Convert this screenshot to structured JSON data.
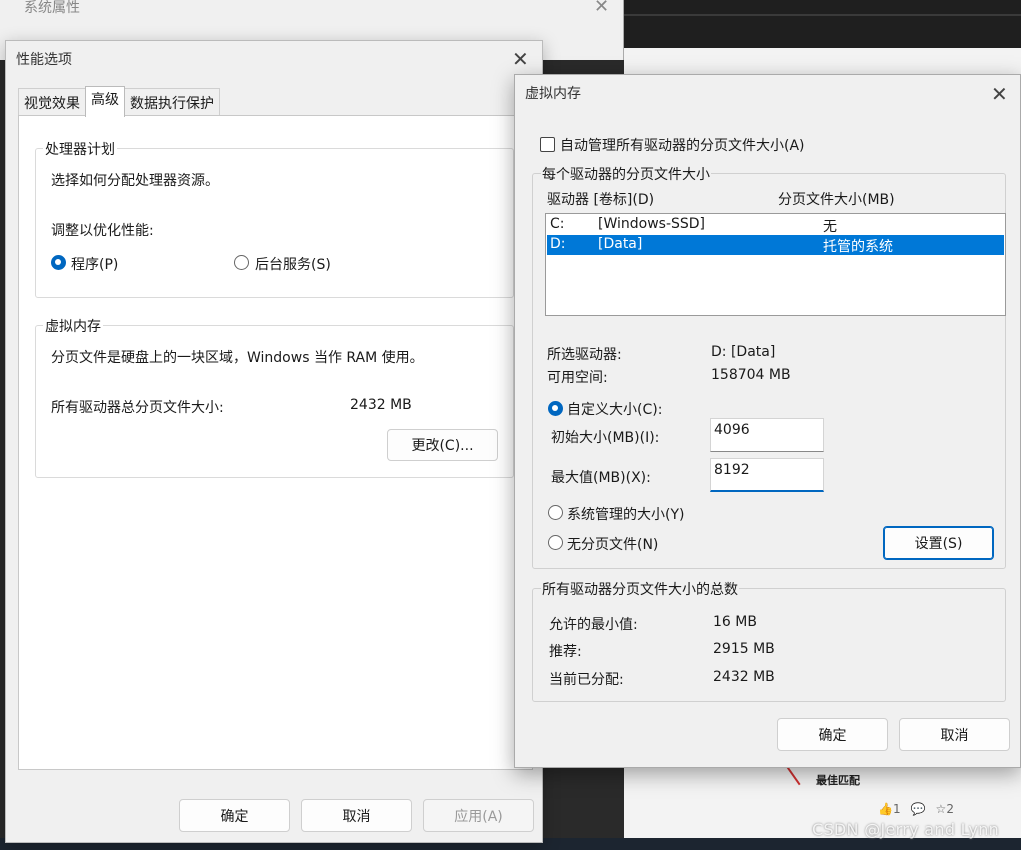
{
  "system_properties": {
    "title": "系统属性"
  },
  "performance_options": {
    "title": "性能选项",
    "tabs": [
      "视觉效果",
      "高级",
      "数据执行保护"
    ],
    "processor_group": {
      "label": "处理器计划",
      "description": "选择如何分配处理器资源。",
      "adjust_label": "调整以优化性能:",
      "option_programs": "程序(P)",
      "option_background": "后台服务(S)"
    },
    "vm_group": {
      "label": "虚拟内存",
      "description": "分页文件是硬盘上的一块区域，Windows 当作 RAM 使用。",
      "total_label": "所有驱动器总分页文件大小:",
      "total_value": "2432 MB",
      "change_button": "更改(C)..."
    },
    "buttons": {
      "ok": "确定",
      "cancel": "取消",
      "apply": "应用(A)"
    }
  },
  "virtual_memory": {
    "title": "虚拟内存",
    "auto_manage_label": "自动管理所有驱动器的分页文件大小(A)",
    "auto_manage_checked": false,
    "per_drive_group": "每个驱动器的分页文件大小",
    "columns": {
      "drive": "驱动器 [卷标](D)",
      "size": "分页文件大小(MB)"
    },
    "drives": [
      {
        "letter": "C:",
        "label": "[Windows-SSD]",
        "size": "无",
        "selected": false
      },
      {
        "letter": "D:",
        "label": "[Data]",
        "size": "托管的系统",
        "selected": true
      }
    ],
    "selected_drive_label": "所选驱动器:",
    "selected_drive_value": "D:  [Data]",
    "free_space_label": "可用空间:",
    "free_space_value": "158704 MB",
    "custom_size_label": "自定义大小(C):",
    "initial_size_label": "初始大小(MB)(I):",
    "initial_size_value": "4096",
    "max_size_label": "最大值(MB)(X):",
    "max_size_value": "8192",
    "system_managed_label": "系统管理的大小(Y)",
    "no_paging_label": "无分页文件(N)",
    "set_button": "设置(S)",
    "totals_group": "所有驱动器分页文件大小的总数",
    "min_allowed_label": "允许的最小值:",
    "min_allowed_value": "16 MB",
    "recommended_label": "推荐:",
    "recommended_value": "2915 MB",
    "current_label": "当前已分配:",
    "current_value": "2432 MB",
    "buttons": {
      "ok": "确定",
      "cancel": "取消"
    }
  },
  "background": {
    "best_match": "最佳匹配",
    "likes": "1",
    "stars": "2",
    "watermark": "CSDN @Jerry and Lynn"
  },
  "colors": {
    "accent": "#0067c0",
    "selection": "#0078d7"
  }
}
